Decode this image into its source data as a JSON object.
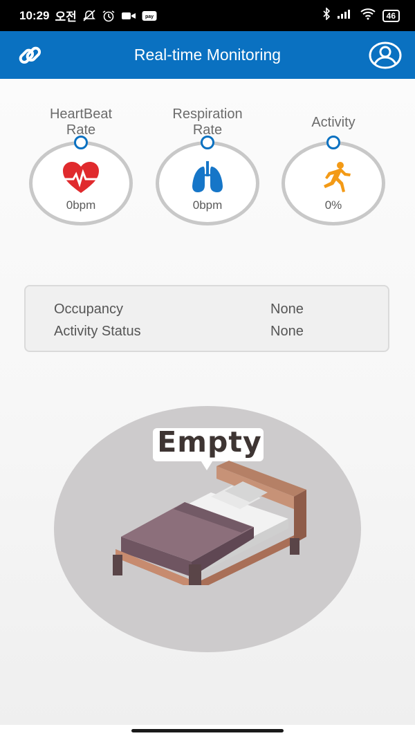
{
  "status_bar": {
    "time": "10:29",
    "ampm": "오전",
    "pay_label": "pay",
    "battery": "46"
  },
  "app_bar": {
    "title": "Real-time Monitoring"
  },
  "gauges": [
    {
      "label": "HeartBeat\nRate",
      "value": "0bpm",
      "icon": "heart-pulse-icon",
      "color": "#e02a2d"
    },
    {
      "label": "Respiration\nRate",
      "value": "0bpm",
      "icon": "lungs-icon",
      "color": "#1676c8"
    },
    {
      "label": "Activity",
      "value": "0%",
      "icon": "running-person-icon",
      "color": "#f39a16"
    }
  ],
  "info": {
    "occupancy_label": "Occupancy",
    "occupancy_value": "None",
    "activity_label": "Activity Status",
    "activity_value": "None"
  },
  "bed_status": {
    "text": "Empty"
  },
  "colors": {
    "primary": "#0a71c1",
    "ring": "#c8c8c8"
  }
}
